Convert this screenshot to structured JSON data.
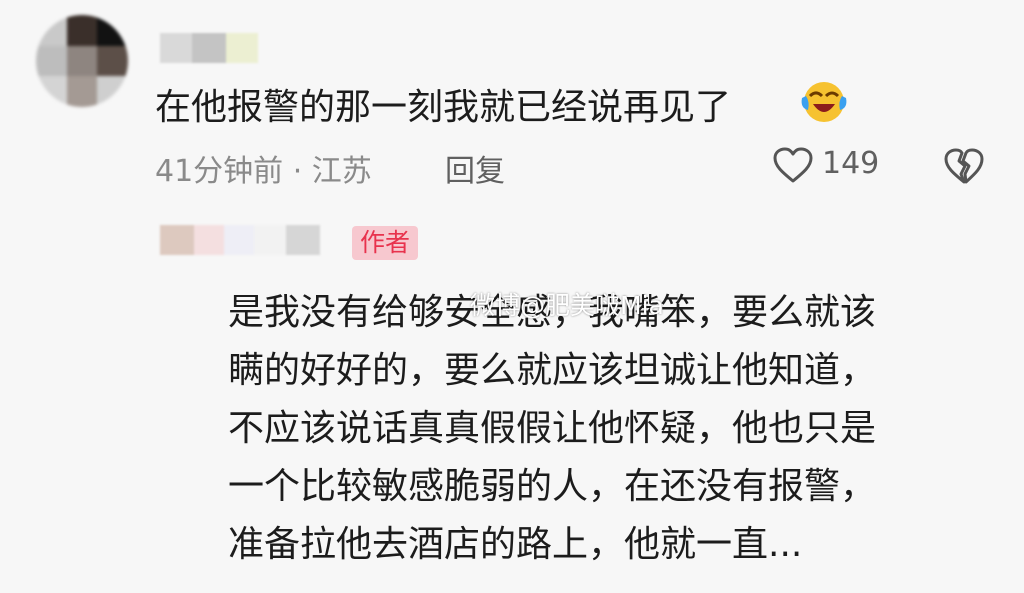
{
  "comment": {
    "text": "在他报警的那一刻我就已经说再见了",
    "emoji": "laughing-crying-emoji",
    "time_location": "41分钟前 · 江苏",
    "reply_label": "回复",
    "like_count": "149"
  },
  "author_reply": {
    "badge": "作者",
    "lines": [
      "是我没有给够安全感，我嘴笨，要么就该",
      "瞒的好好的，要么就应该坦诚让他知道，",
      "不应该说话真真假假让他怀疑，他也只是",
      "一个比较敏感脆弱的人，在还没有报警，",
      "准备拉他去酒店的路上，他就一直..."
    ]
  },
  "watermark": "微博@肥美啵Mia",
  "colors": {
    "background": "#f7f7f7",
    "badge_bg": "#f7c8cf",
    "badge_text": "#e8324d",
    "meta_text": "#8a8a8a"
  }
}
